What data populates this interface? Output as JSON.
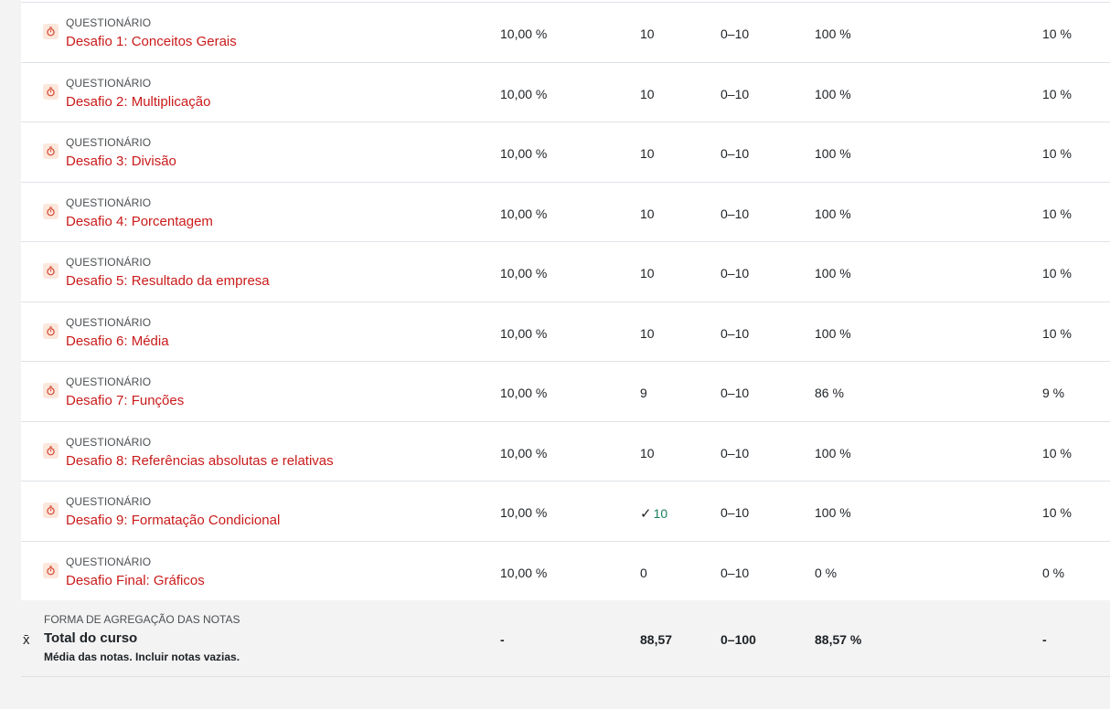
{
  "items": [
    {
      "category": "QUESTIONÁRIO",
      "name": "Desafio 1: Conceitos Gerais",
      "weight": "10,00 %",
      "grade": "10",
      "range": "0–10",
      "percentage": "100 %",
      "contribution": "10 %"
    },
    {
      "category": "QUESTIONÁRIO",
      "name": "Desafio 2: Multiplicação",
      "weight": "10,00 %",
      "grade": "10",
      "range": "0–10",
      "percentage": "100 %",
      "contribution": "10 %"
    },
    {
      "category": "QUESTIONÁRIO",
      "name": "Desafio 3: Divisão",
      "weight": "10,00 %",
      "grade": "10",
      "range": "0–10",
      "percentage": "100 %",
      "contribution": "10 %"
    },
    {
      "category": "QUESTIONÁRIO",
      "name": "Desafio 4: Porcentagem",
      "weight": "10,00 %",
      "grade": "10",
      "range": "0–10",
      "percentage": "100 %",
      "contribution": "10 %"
    },
    {
      "category": "QUESTIONÁRIO",
      "name": "Desafio 5: Resultado da empresa",
      "weight": "10,00 %",
      "grade": "10",
      "range": "0–10",
      "percentage": "100 %",
      "contribution": "10 %"
    },
    {
      "category": "QUESTIONÁRIO",
      "name": "Desafio 6: Média",
      "weight": "10,00 %",
      "grade": "10",
      "range": "0–10",
      "percentage": "100 %",
      "contribution": "10 %"
    },
    {
      "category": "QUESTIONÁRIO",
      "name": "Desafio 7: Funções",
      "weight": "10,00 %",
      "grade": "9",
      "range": "0–10",
      "percentage": "86 %",
      "contribution": "9 %"
    },
    {
      "category": "QUESTIONÁRIO",
      "name": "Desafio 8: Referências absolutas e relativas",
      "weight": "10,00 %",
      "grade": "10",
      "range": "0–10",
      "percentage": "100 %",
      "contribution": "10 %"
    },
    {
      "category": "QUESTIONÁRIO",
      "name": "Desafio 9: Formatação Condicional",
      "weight": "10,00 %",
      "grade": "10",
      "grade_checked": true,
      "range": "0–10",
      "percentage": "100 %",
      "contribution": "10 %"
    },
    {
      "category": "QUESTIONÁRIO",
      "name": "Desafio Final: Gráficos",
      "weight": "10,00 %",
      "grade": "0",
      "range": "0–10",
      "percentage": "0 %",
      "contribution": "0 %"
    }
  ],
  "total": {
    "aggregation_label": "FORMA DE AGREGAÇÃO DAS NOTAS",
    "name": "Total do curso",
    "description": "Média das notas. Incluir notas vazias.",
    "weight": "-",
    "grade": "88,57",
    "range": "0–100",
    "percentage": "88,57 %",
    "contribution": "-"
  },
  "icons": {
    "item_icon": "quiz-icon",
    "total_icon": "mean-icon",
    "check_icon": "checkmark-icon"
  },
  "colors": {
    "link": "#ca1a1a",
    "graded_check": "#1a7f5a",
    "quiz_icon_bg": "#fbe7dc"
  }
}
